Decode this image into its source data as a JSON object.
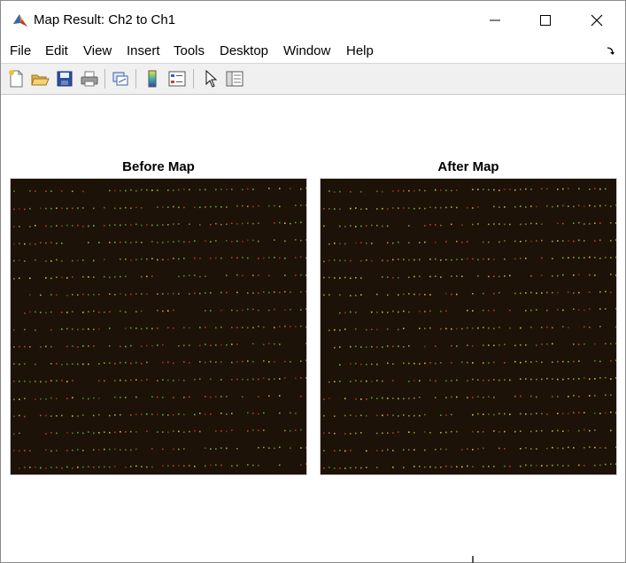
{
  "window": {
    "title": "Map Result: Ch2 to Ch1",
    "controls": [
      "minimize",
      "maximize",
      "close"
    ]
  },
  "menu": {
    "items": [
      "File",
      "Edit",
      "View",
      "Insert",
      "Tools",
      "Desktop",
      "Window",
      "Help"
    ]
  },
  "toolbar": {
    "icons": [
      "new-figure-icon",
      "open-file-icon",
      "save-icon",
      "print-icon",
      "link-plot-icon",
      "insert-colorbar-icon",
      "insert-legend-icon",
      "pointer-icon",
      "property-inspector-icon"
    ]
  },
  "axes": [
    {
      "title": "Before Map"
    },
    {
      "title": "After Map"
    }
  ],
  "colors": {
    "image_background": "#1d1208",
    "spot_green": "#6fbf3a",
    "spot_red": "#c8492c",
    "spot_yellow": "#d9c64a"
  }
}
